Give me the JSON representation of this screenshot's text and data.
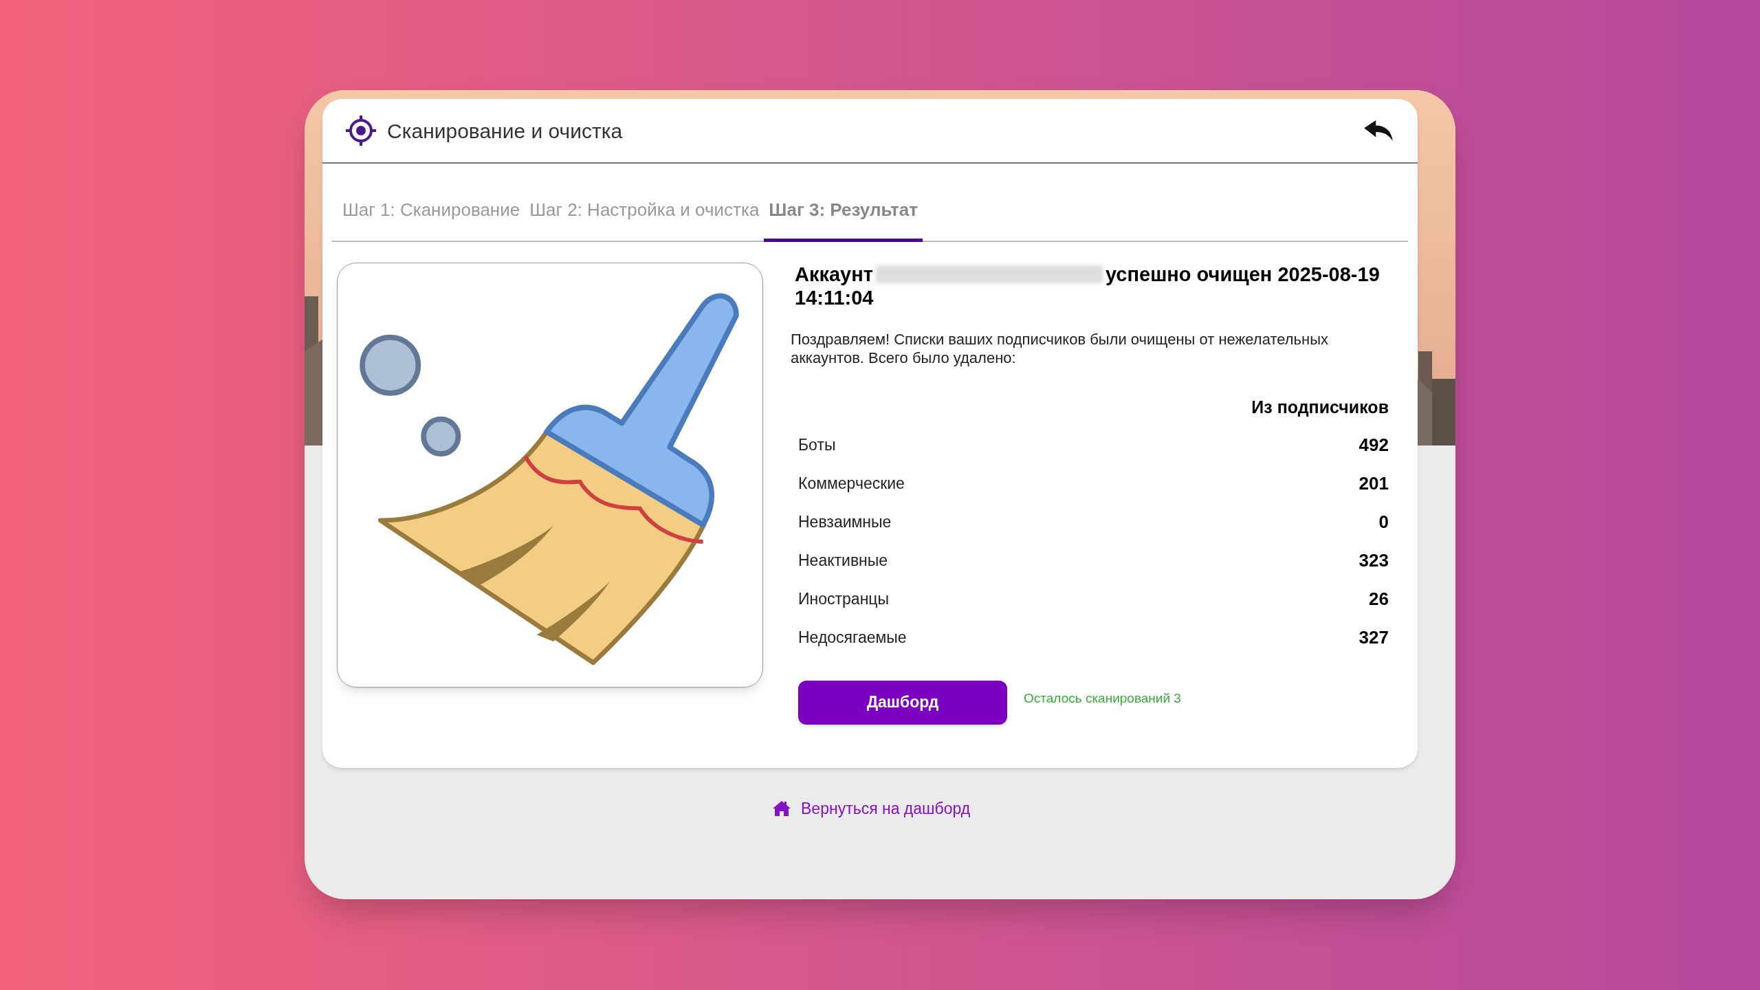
{
  "header": {
    "title": "Сканирование и очистка"
  },
  "tabs": [
    {
      "label": "Шаг 1: Сканирование",
      "selected": false
    },
    {
      "label": "Шаг 2: Настройка и очистка",
      "selected": false
    },
    {
      "label": "Шаг 3: Результат",
      "selected": true
    }
  ],
  "result": {
    "heading_before": "Аккаунт",
    "heading_after": "успешно очищен 2025-08-19",
    "heading_time": "14:11:04",
    "message": "Поздравляем! Списки ваших подписчиков были очищены от нежелательных аккаунтов. Всего было удалено:"
  },
  "table": {
    "column_header": "Из подписчиков",
    "rows": [
      {
        "label": "Боты",
        "value": "492"
      },
      {
        "label": "Коммерческие",
        "value": "201"
      },
      {
        "label": "Невзаимные",
        "value": "0"
      },
      {
        "label": "Неактивные",
        "value": "323"
      },
      {
        "label": "Иностранцы",
        "value": "26"
      },
      {
        "label": "Недосягаемые",
        "value": "327"
      }
    ]
  },
  "dashboard_button": "Дашборд",
  "scans_left": "Осталось сканирований 3",
  "back_link": "Вернуться на дашборд"
}
